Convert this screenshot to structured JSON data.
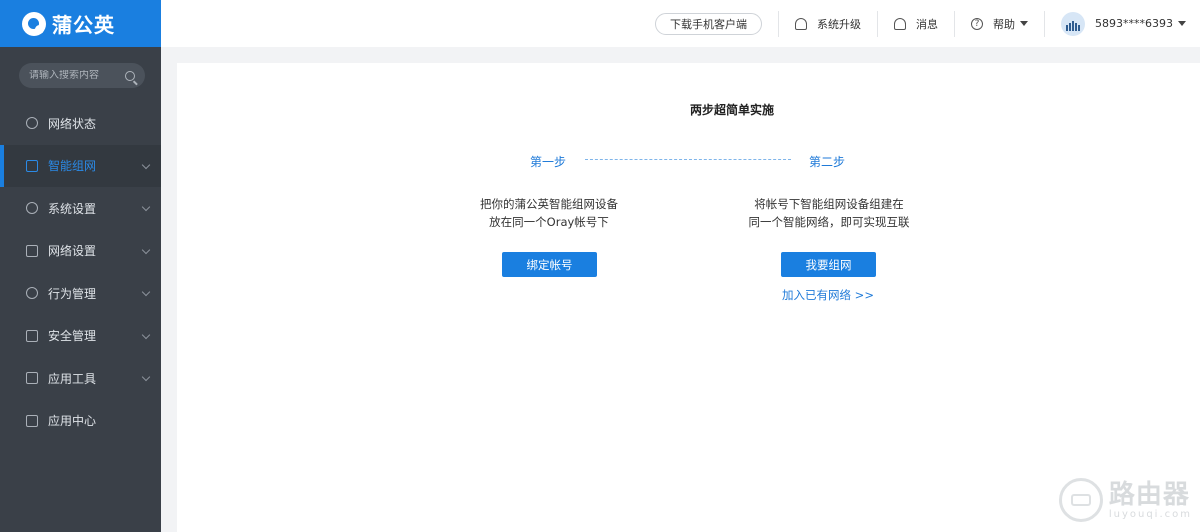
{
  "app": {
    "logo_text": "蒲公英"
  },
  "sidebar": {
    "search_placeholder": "请输入搜索内容",
    "items": [
      {
        "label": "网络状态",
        "icon": "network-status-icon",
        "has_chevron": false,
        "active": false
      },
      {
        "label": "智能组网",
        "icon": "smart-network-icon",
        "has_chevron": true,
        "active": true
      },
      {
        "label": "系统设置",
        "icon": "system-settings-icon",
        "has_chevron": true,
        "active": false
      },
      {
        "label": "网络设置",
        "icon": "network-settings-icon",
        "has_chevron": true,
        "active": false
      },
      {
        "label": "行为管理",
        "icon": "behavior-management-icon",
        "has_chevron": true,
        "active": false
      },
      {
        "label": "安全管理",
        "icon": "security-icon",
        "has_chevron": true,
        "active": false
      },
      {
        "label": "应用工具",
        "icon": "toolbox-icon",
        "has_chevron": true,
        "active": false
      },
      {
        "label": "应用中心",
        "icon": "app-center-icon",
        "has_chevron": false,
        "active": false
      }
    ]
  },
  "header": {
    "download_client": "下载手机客户端",
    "system_upgrade": "系统升级",
    "messages": "消息",
    "help": "帮助",
    "account": "5893****6393"
  },
  "main": {
    "title": "两步超简单实施",
    "step1": {
      "label": "第一步",
      "desc_line1": "把你的蒲公英智能组网设备",
      "desc_line2": "放在同一个Oray帐号下",
      "button": "绑定帐号"
    },
    "step2": {
      "label": "第二步",
      "desc_line1": "将帐号下智能组网设备组建在",
      "desc_line2": "同一个智能网络，即可实现互联",
      "button": "我要组网",
      "link": "加入已有网络 >>"
    }
  },
  "watermark": {
    "title": "路由器",
    "subtitle": "luyouqi.com"
  },
  "colors": {
    "brand": "#1a7fe0",
    "sidebar_bg": "#3a4048",
    "link": "#1f7ad8"
  }
}
